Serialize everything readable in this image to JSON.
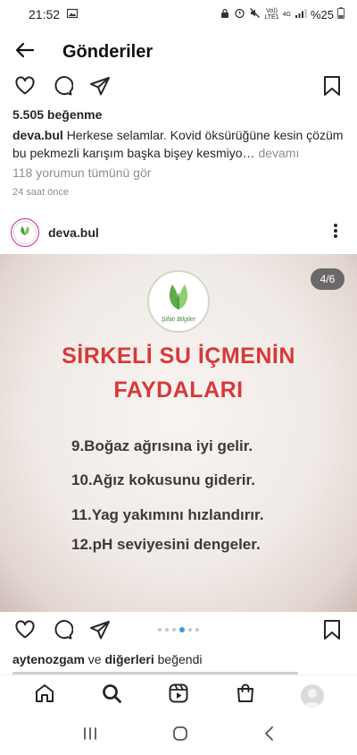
{
  "status_bar": {
    "time": "21:52",
    "network_top": "Vo))",
    "network_bottom": "LTE1",
    "net_type": "4G",
    "battery": "%25"
  },
  "header": {
    "title": "Gönderiler"
  },
  "previous_post": {
    "likes": "5.505 beğenme",
    "caption_user": "deva.bul",
    "caption_text": "Herkese selamlar. Kovid öksürüğüne kesin çözüm bu pekmezli karışım başka bişey kesmiyo…",
    "more_label": "devamı",
    "comments_link": "118 yorumun tümünü gör",
    "timestamp": "24 saat önce"
  },
  "post": {
    "username": "deva.bul",
    "counter": "4/6",
    "logo_text": "Şifalı Bilgiler",
    "title_line1": "SİRKELİ SU İÇMENİN",
    "title_line2": "FAYDALARI",
    "benefits": [
      "9.Boğaz ağrısına iyi gelir.",
      "10.Ağız kokusunu giderir.",
      "11.Yag yakımını hızlandırır.",
      "12.pH seviyesini dengeler."
    ],
    "liked_by_user": "aytenozgam",
    "liked_by_mid": " ve ",
    "liked_by_others": "diğerleri",
    "liked_by_end": " beğendi"
  },
  "colors": {
    "accent": "#3897f0",
    "title_red": "#d63a3a",
    "leaf_green": "#4a9b3e"
  },
  "icons": {
    "back": "arrow-left-icon",
    "like": "heart-icon",
    "comment": "comment-icon",
    "share": "send-icon",
    "save": "bookmark-icon",
    "more": "more-vertical-icon",
    "nav": [
      "home-icon",
      "search-icon",
      "reels-icon",
      "shop-icon",
      "profile-icon"
    ]
  }
}
